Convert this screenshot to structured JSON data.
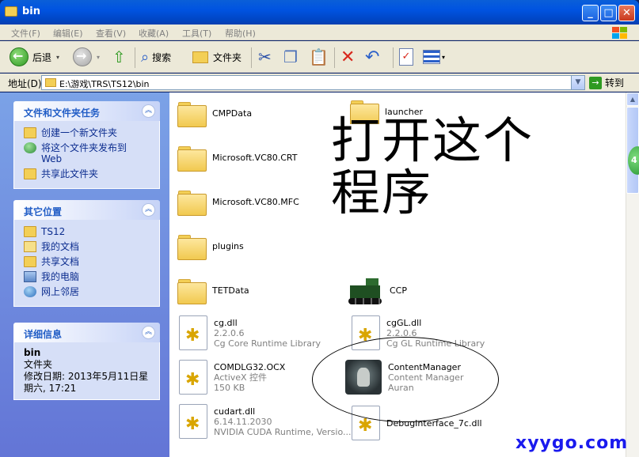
{
  "window": {
    "title": "bin"
  },
  "menu": {
    "items": [
      "文件(F)",
      "编辑(E)",
      "查看(V)",
      "收藏(A)",
      "工具(T)",
      "帮助(H)"
    ]
  },
  "toolbar": {
    "back_label": "后退",
    "search_label": "搜索",
    "folders_label": "文件夹"
  },
  "address": {
    "label": "地址(D)",
    "path": "E:\\游戏\\TRS\\TS12\\bin",
    "go_label": "转到"
  },
  "tasks_panel": {
    "title": "文件和文件夹任务",
    "items": [
      {
        "label": "创建一个新文件夹"
      },
      {
        "label": "将这个文件夹发布到 Web"
      },
      {
        "label": "共享此文件夹"
      }
    ]
  },
  "other_places": {
    "title": "其它位置",
    "items": [
      {
        "label": "TS12"
      },
      {
        "label": "我的文档"
      },
      {
        "label": "共享文档"
      },
      {
        "label": "我的电脑"
      },
      {
        "label": "网上邻居"
      }
    ]
  },
  "details": {
    "title": "详细信息",
    "name": "bin",
    "type": "文件夹",
    "modified": "修改日期: 2013年5月11日星期六, 17:21"
  },
  "files": [
    {
      "name": "CMPData"
    },
    {
      "name": "launcher"
    },
    {
      "name": "Microsoft.VC80.CRT"
    },
    {
      "name": "Microsoft.VC80.MFC"
    },
    {
      "name": "plugins"
    },
    {
      "name": "TETData"
    },
    {
      "name": "CCP"
    },
    {
      "name": "cg.dll",
      "line2": "2.2.0.6",
      "line3": "Cg Core Runtime Library"
    },
    {
      "name": "cgGL.dll",
      "line2": "2.2.0.6",
      "line3": "Cg GL Runtime Library"
    },
    {
      "name": "COMDLG32.OCX",
      "line2": "ActiveX 控件",
      "line3": "150 KB"
    },
    {
      "name": "ContentManager",
      "line2": "Content Manager",
      "line3": "Auran"
    },
    {
      "name": "cudart.dll",
      "line2": "6.14.11.2030",
      "line3": "NVIDIA CUDA Runtime, Versio..."
    },
    {
      "name": "DebugInterface_7c.dll"
    }
  ],
  "annotation": {
    "line1": "打开这个",
    "line2": "程序"
  },
  "scroll_badge": "4",
  "watermark": "xyygo.com"
}
